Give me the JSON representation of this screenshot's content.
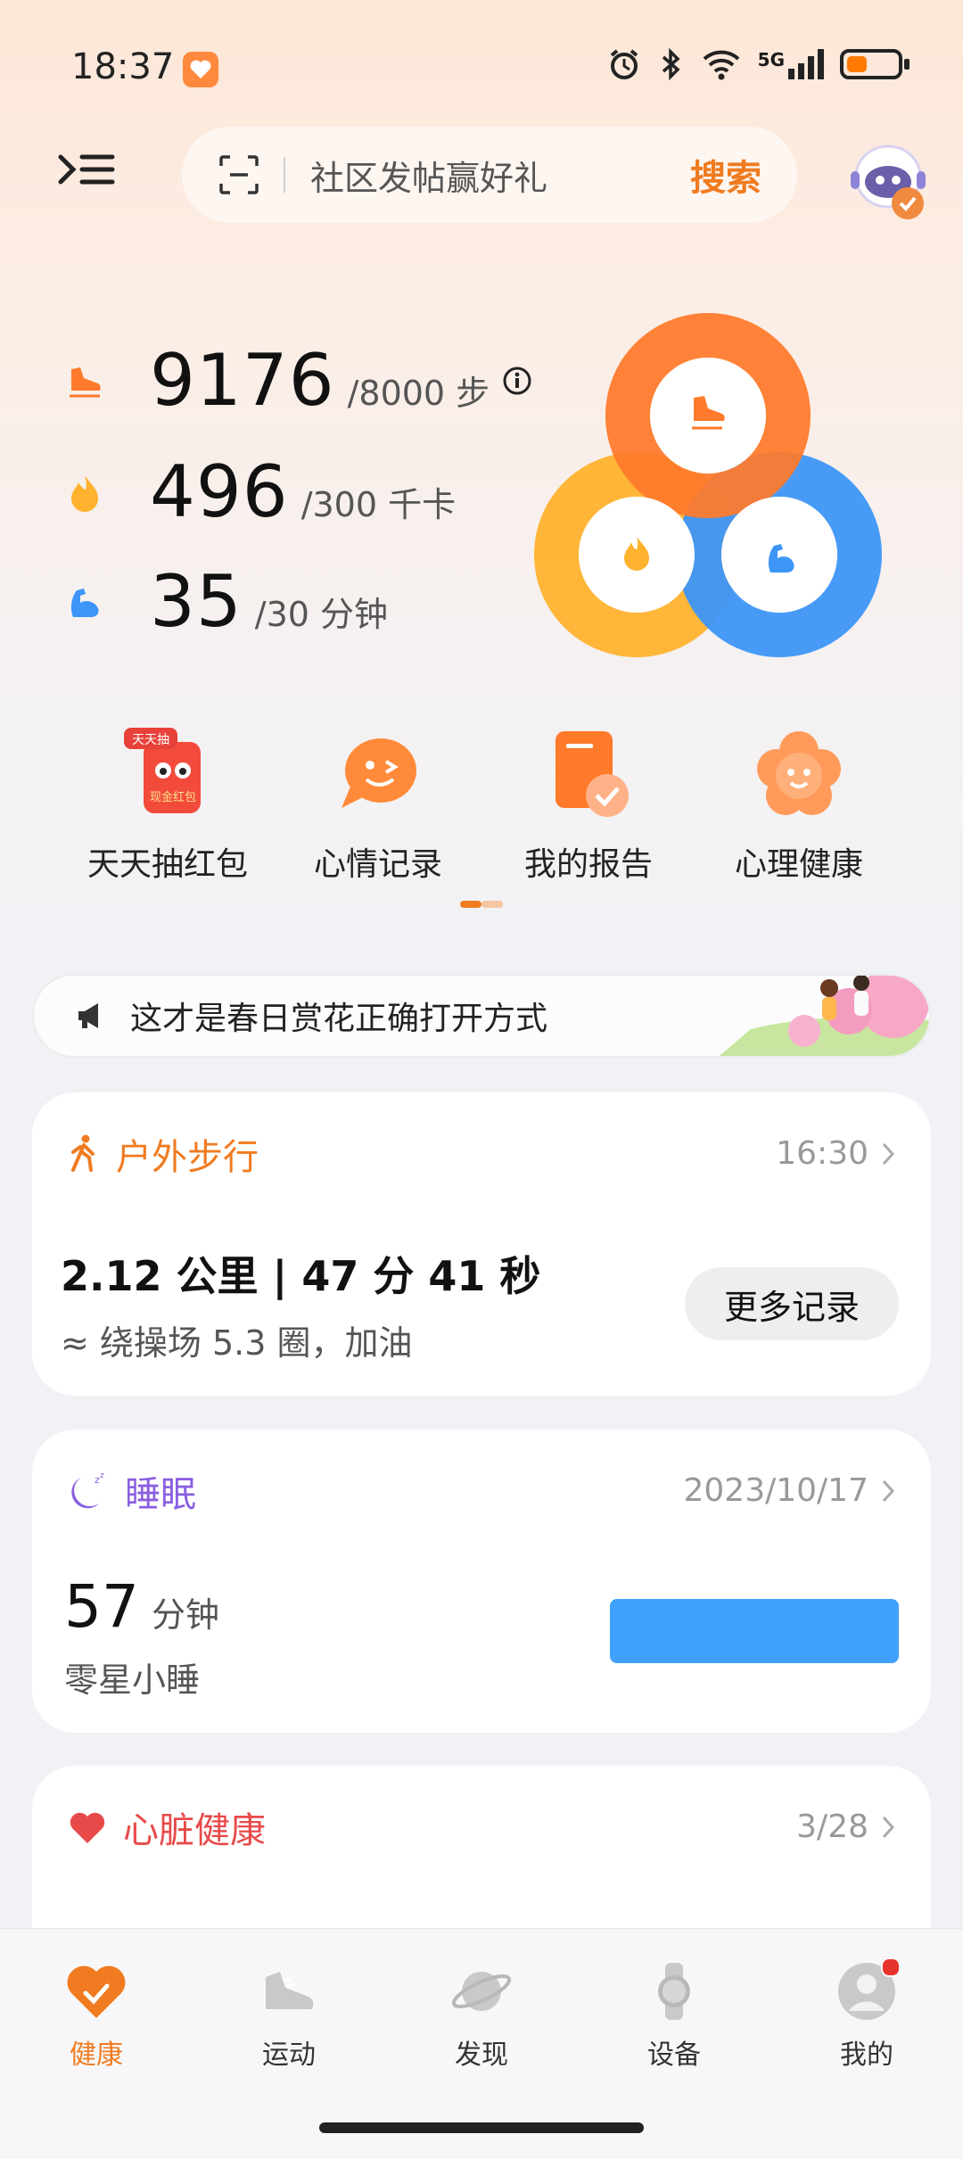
{
  "status_bar": {
    "time": "18:37",
    "network": "5G"
  },
  "header": {
    "search_placeholder": "社区发帖赢好礼",
    "search_button": "搜索"
  },
  "stats": {
    "steps": {
      "value": "9176",
      "target": "/8000 步"
    },
    "calories": {
      "value": "496",
      "target": "/300 千卡"
    },
    "active_minutes": {
      "value": "35",
      "target": "/30 分钟"
    }
  },
  "quick_actions": [
    {
      "label": "天天抽红包",
      "badge": "天天抽",
      "icon_text": "现金红包"
    },
    {
      "label": "心情记录"
    },
    {
      "label": "我的报告"
    },
    {
      "label": "心理健康"
    }
  ],
  "banner": {
    "text": "这才是春日赏花正确打开方式"
  },
  "cards": {
    "outdoor_walk": {
      "title": "户外步行",
      "time": "16:30",
      "summary": "2.12 公里 | 47 分 41 秒",
      "detail": "≈ 绕操场 5.3 圈，加油",
      "more_button": "更多记录"
    },
    "sleep": {
      "title": "睡眠",
      "date": "2023/10/17",
      "value": "57",
      "unit": "分钟",
      "label": "零星小睡"
    },
    "heart": {
      "title": "心脏健康",
      "date": "3/28"
    }
  },
  "tabs": [
    {
      "label": "健康",
      "active": true
    },
    {
      "label": "运动"
    },
    {
      "label": "发现"
    },
    {
      "label": "设备"
    },
    {
      "label": "我的"
    }
  ],
  "colors": {
    "accent": "#f07b20",
    "steps_ring": "#ff7a2a",
    "calories_ring": "#ffb22e",
    "activity_ring": "#3d96f7",
    "sleep_purple": "#8a5fe0",
    "heart_red": "#e84a4a",
    "sleep_bar": "#3fa1fb"
  }
}
